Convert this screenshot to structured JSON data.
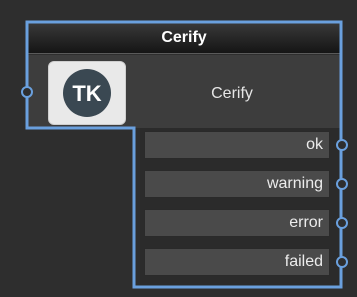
{
  "node": {
    "header_title": "Cerify",
    "title": "Cerify",
    "logo_text": "TK",
    "outputs": [
      {
        "label": "ok"
      },
      {
        "label": "warning"
      },
      {
        "label": "error"
      },
      {
        "label": "failed"
      }
    ]
  },
  "colors": {
    "outline": "#6aa0de",
    "canvas": "#2e2e2e",
    "header_top": "#3a3a3a",
    "header_bottom": "#151515",
    "button": "#4a4a4a",
    "logo_circle": "#3a4852"
  }
}
